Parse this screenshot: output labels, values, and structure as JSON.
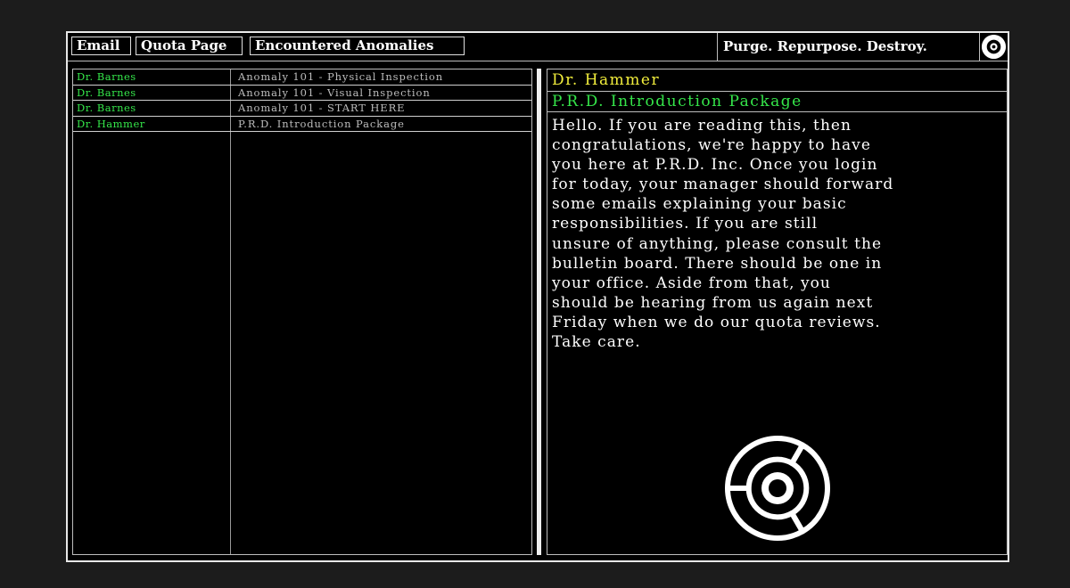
{
  "tabs": {
    "email": "Email",
    "quota": "Quota Page",
    "anomalies": "Encountered Anomalies"
  },
  "motto": "Purge. Repurpose. Destroy.",
  "logo_icon": "radiation-icon",
  "colors": {
    "sender": "#35e64a",
    "from": "#f2ee3c",
    "subject_line": "#35e64a",
    "list_subject": "#bdbdbd"
  },
  "emails": [
    {
      "sender": "Dr. Barnes",
      "subject": "Anomaly 101 - Physical Inspection"
    },
    {
      "sender": "Dr. Barnes",
      "subject": "Anomaly 101 - Visual Inspection"
    },
    {
      "sender": "Dr. Barnes",
      "subject": "Anomaly 101 - START HERE"
    },
    {
      "sender": "Dr. Hammer",
      "subject": "P.R.D. Introduction Package"
    }
  ],
  "message": {
    "from": "Dr. Hammer",
    "subject": "P.R.D. Introduction Package",
    "body": "Hello. If you are reading this, then\ncongratulations, we're happy to have\nyou here at P.R.D. Inc. Once you login\nfor today, your manager should forward\nsome emails explaining your basic\nresponsibilities. If you are still\nunsure of anything, please consult the\nbulletin board. There should be one in\nyour office. Aside from that, you\nshould be hearing from us again next\nFriday when we do our quota reviews.\nTake care."
  }
}
